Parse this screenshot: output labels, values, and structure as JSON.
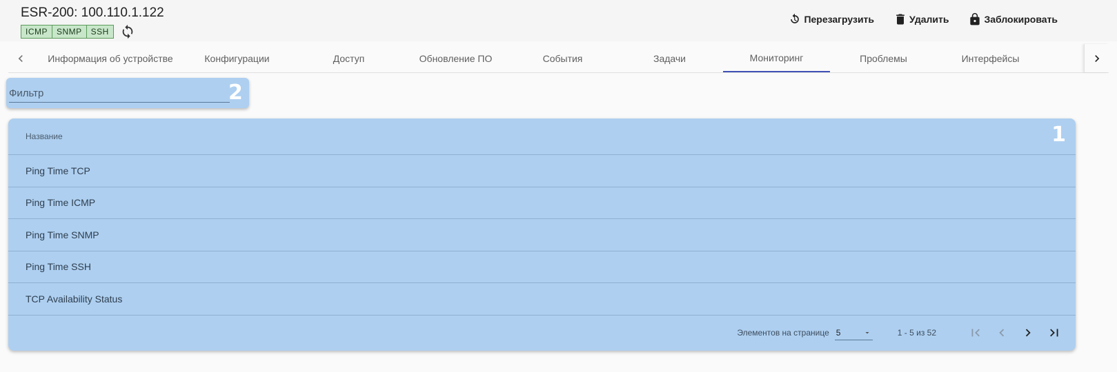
{
  "header": {
    "title": "ESR-200: 100.110.1.122",
    "protocols": [
      "ICMP",
      "SNMP",
      "SSH"
    ]
  },
  "actions": {
    "reboot": "Перезагрузить",
    "delete": "Удалить",
    "lock": "Заблокировать"
  },
  "tabs": [
    {
      "label": "Информация об устройстве"
    },
    {
      "label": "Конфигурации"
    },
    {
      "label": "Доступ"
    },
    {
      "label": "Обновление ПО"
    },
    {
      "label": "События"
    },
    {
      "label": "Задачи"
    },
    {
      "label": "Мониторинг"
    },
    {
      "label": "Проблемы"
    },
    {
      "label": "Интерфейсы"
    }
  ],
  "active_tab": "Мониторинг",
  "filter": {
    "placeholder": "Фильтр",
    "value": ""
  },
  "markers": {
    "filter": "2",
    "table": "1"
  },
  "table": {
    "column": "Название",
    "rows": [
      "Ping Time TCP",
      "Ping Time ICMP",
      "Ping Time SNMP",
      "Ping Time SSH",
      "TCP Availability Status"
    ]
  },
  "paginator": {
    "items_per_page_label": "Элементов на странице",
    "page_size": "5",
    "range": "1 - 5 из 52"
  }
}
